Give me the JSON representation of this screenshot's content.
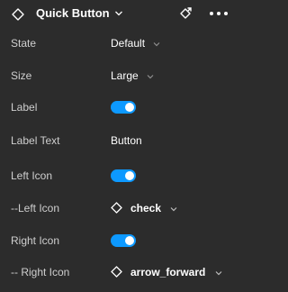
{
  "header": {
    "title": "Quick Button",
    "component_icon": "component-diamond-icon",
    "detach_icon": "detach-instance-icon",
    "more_icon": "more-horizontal-icon"
  },
  "properties": {
    "state": {
      "label": "State",
      "value": "Default"
    },
    "size": {
      "label": "Size",
      "value": "Large"
    },
    "label_toggle": {
      "label": "Label",
      "on": true
    },
    "label_text": {
      "label": "Label Text",
      "value": "Button"
    },
    "left_icon_toggle": {
      "label": "Left Icon",
      "on": true
    },
    "left_icon_swap": {
      "label": "--Left Icon",
      "value": "check"
    },
    "right_icon_toggle": {
      "label": "Right Icon",
      "on": true
    },
    "right_icon_swap": {
      "label": "-- Right Icon",
      "value": "arrow_forward"
    }
  },
  "colors": {
    "background": "#2c2c2c",
    "toggle_on": "#0d99ff",
    "label_text": "#cfcfcf",
    "value_text": "#ffffff"
  }
}
